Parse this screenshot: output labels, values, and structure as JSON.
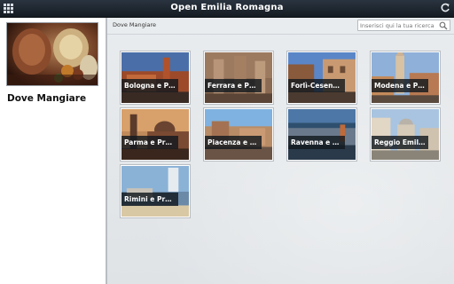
{
  "app": {
    "title": "Open Emilia Romagna",
    "menu_icon": "grid-icon",
    "refresh_icon": "refresh-icon"
  },
  "sidebar": {
    "category_title": "Dove Mangiare"
  },
  "main": {
    "breadcrumb": "Dove Mangiare",
    "search_placeholder": "Inserisci qui la tua ricerca",
    "tiles": [
      {
        "label": "Bologna e Provincia"
      },
      {
        "label": "Ferrara e Provincia"
      },
      {
        "label": "Forlì-Cesena e Provincia"
      },
      {
        "label": "Modena e Provincia"
      },
      {
        "label": "Parma e Provincia"
      },
      {
        "label": "Piacenza e Provincia"
      },
      {
        "label": "Ravenna e Provincia"
      },
      {
        "label": "Reggio Emilia e Provincia"
      },
      {
        "label": "Rimini e Provincia"
      }
    ]
  },
  "colors": {
    "topbar": "#1b232c",
    "caption_bg": "#12181e",
    "sidebar_bg": "#ffffff",
    "main_bg": "#e6e8ea"
  }
}
